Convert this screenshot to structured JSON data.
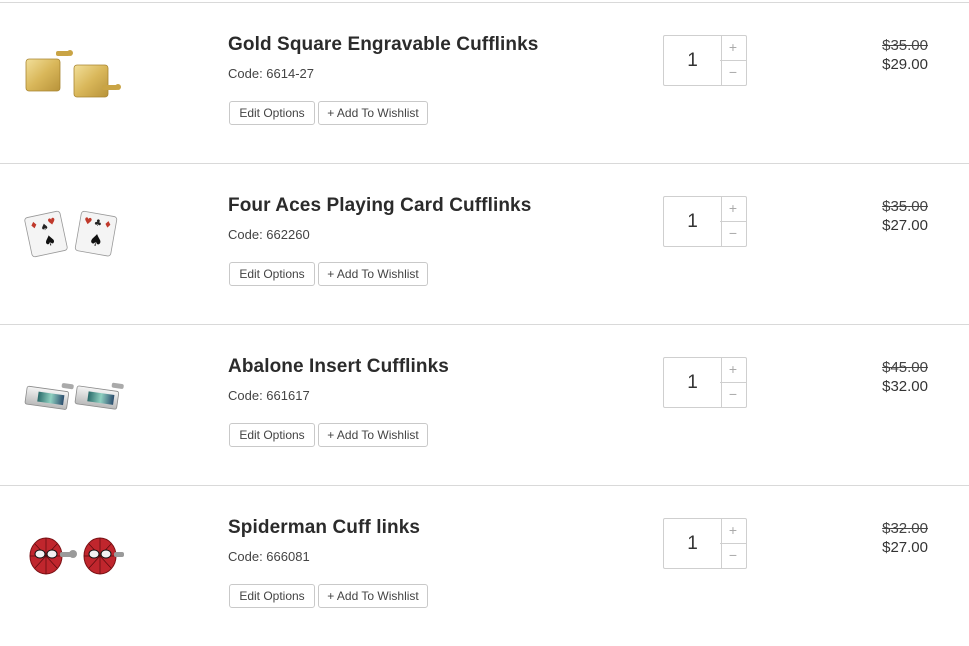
{
  "cart": {
    "items": [
      {
        "name": "Gold Square Engravable Cufflinks",
        "code": "Code: 6614-27",
        "edit_label": "Edit Options",
        "wishlist_label": "+ Add To Wishlist",
        "quantity": "1",
        "plus_symbol": "+",
        "minus_symbol": "−",
        "price_original": "$35.00",
        "price_sale": "$29.00",
        "thumbnail_icon": "gold-square-cufflinks-image"
      },
      {
        "name": "Four Aces Playing Card Cufflinks",
        "code": "Code: 662260",
        "edit_label": "Edit Options",
        "wishlist_label": "+ Add To Wishlist",
        "quantity": "1",
        "plus_symbol": "+",
        "minus_symbol": "−",
        "price_original": "$35.00",
        "price_sale": "$27.00",
        "thumbnail_icon": "playing-card-cufflinks-image"
      },
      {
        "name": "Abalone Insert Cufflinks",
        "code": "Code: 661617",
        "edit_label": "Edit Options",
        "wishlist_label": "+ Add To Wishlist",
        "quantity": "1",
        "plus_symbol": "+",
        "minus_symbol": "−",
        "price_original": "$45.00",
        "price_sale": "$32.00",
        "thumbnail_icon": "abalone-cufflinks-image"
      },
      {
        "name": "Spiderman Cuff links",
        "code": "Code: 666081",
        "edit_label": "Edit Options",
        "wishlist_label": "+ Add To Wishlist",
        "quantity": "1",
        "plus_symbol": "+",
        "minus_symbol": "−",
        "price_original": "$32.00",
        "price_sale": "$27.00",
        "thumbnail_icon": "spiderman-cufflinks-image"
      }
    ]
  }
}
